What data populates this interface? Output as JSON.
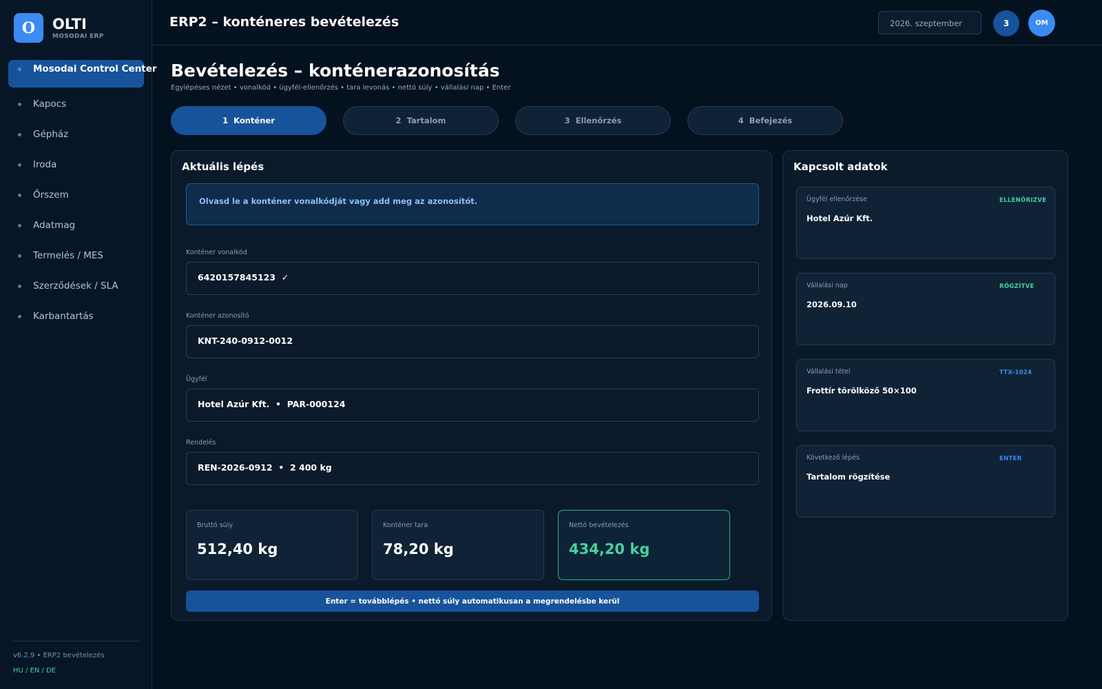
{
  "brand": {
    "logo_letter": "O",
    "name": "OLTI",
    "subtitle": "MOSODAI ERP"
  },
  "sidebar": {
    "items": [
      {
        "label": "Mosodai Control Center",
        "active": true
      },
      {
        "label": "Kapocs"
      },
      {
        "label": "Gépház"
      },
      {
        "label": "Iroda"
      },
      {
        "label": "Őrszem"
      },
      {
        "label": "Adatmag"
      },
      {
        "label": "Termelés / MES"
      },
      {
        "label": "Szerződések / SLA"
      },
      {
        "label": "Karbantartás"
      }
    ],
    "version": "v6.2.9 • ERP2 bevételezés",
    "languages": "HU / EN / DE"
  },
  "header": {
    "title": "ERP2 – konténeres bevételezés",
    "date": "2026. szeptember",
    "notifications": "3",
    "avatar_initials": "OM"
  },
  "page": {
    "title": "Bevételezés – konténerazonosítás",
    "subtitle": "Egylépéses nézet • vonalkód • ügyfél-ellenőrzés • tara levonás • nettó súly • vállalási nap • Enter"
  },
  "steps": [
    {
      "num": "1",
      "label": "Konténer",
      "active": true
    },
    {
      "num": "2",
      "label": "Tartalom"
    },
    {
      "num": "3",
      "label": "Ellenőrzés"
    },
    {
      "num": "4",
      "label": "Befejezés"
    }
  ],
  "current_step": {
    "title": "Aktuális lépés",
    "hint": "Olvasd le a konténer vonalkódját vagy add meg az azonosítót.",
    "fields": [
      {
        "label": "Konténer vonalkód",
        "value": "6420157845123  ✓"
      },
      {
        "label": "Konténer azonosító",
        "value": "KNT-240-0912-0012"
      },
      {
        "label": "Ügyfél",
        "value": "Hotel Azúr Kft.  •  PAR-000124"
      },
      {
        "label": "Rendelés",
        "value": "REN-2026-0912  •  2 400 kg"
      }
    ],
    "stats": [
      {
        "label": "Bruttó súly",
        "value": "512,40 kg"
      },
      {
        "label": "Konténer tara",
        "value": "78,20 kg"
      },
      {
        "label": "Nettó bevételezés",
        "value": "434,20 kg"
      }
    ],
    "enter_hint": "Enter = továbblépés • nettó súly automatikusan a megrendelésbe kerül"
  },
  "related": {
    "title": "Kapcsolt adatok",
    "cards": [
      {
        "label": "Ügyfél ellenőrzése",
        "badge": "ELLENŐRIZVE",
        "badge_color": "#44d3a0",
        "value": "Hotel Azúr Kft."
      },
      {
        "label": "Vállalási nap",
        "badge": "RÖGZÍTVE",
        "badge_color": "#44d3a0",
        "value": "2026.09.10"
      },
      {
        "label": "Vállalási tétel",
        "badge": "TTX-1024",
        "badge_color": "#3b8bf5",
        "value": "Frottír törölköző 50×100"
      },
      {
        "label": "Következő lépés",
        "badge": "ENTER",
        "badge_color": "#3b8bf5",
        "value": "Tartalom rögzítése"
      }
    ]
  }
}
